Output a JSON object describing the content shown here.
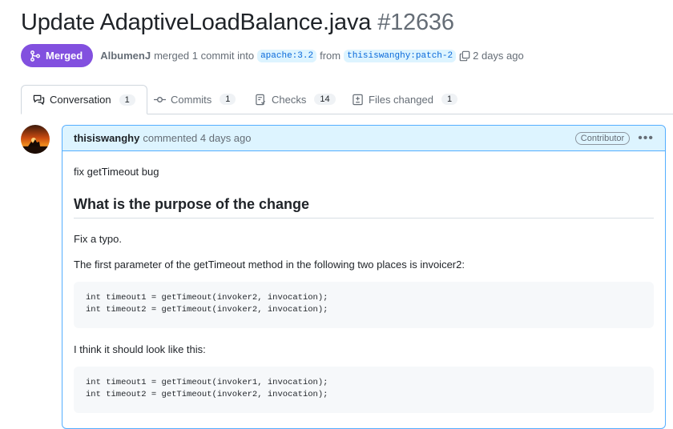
{
  "pr": {
    "title": "Update AdaptiveLoadBalance.java",
    "number": "#12636",
    "status": "Merged",
    "author": "AlbumenJ",
    "merge_text": "merged 1 commit into",
    "base_branch": "apache:3.2",
    "from_text": "from",
    "head_branch": "thisiswanghy:patch-2",
    "time": "2 days ago"
  },
  "tabs": [
    {
      "label": "Conversation",
      "count": "1",
      "icon": "conversation-icon"
    },
    {
      "label": "Commits",
      "count": "1",
      "icon": "commit-icon"
    },
    {
      "label": "Checks",
      "count": "14",
      "icon": "checks-icon"
    },
    {
      "label": "Files changed",
      "count": "1",
      "icon": "diff-icon"
    }
  ],
  "comment": {
    "author": "thisiswanghy",
    "action": "commented 4 days ago",
    "role": "Contributor",
    "intro": "fix getTimeout bug",
    "heading": "What is the purpose of the change",
    "p1": "Fix a typo.",
    "p2": "The first parameter of the getTimeout method in the following two places is invoicer2:",
    "code1": "int timeout1 = getTimeout(invoker2, invocation);\nint timeout2 = getTimeout(invoker2, invocation);",
    "p3": "I think it should look like this:",
    "code2": "int timeout1 = getTimeout(invoker1, invocation);\nint timeout2 = getTimeout(invoker2, invocation);"
  },
  "colors": {
    "merged": "#8250df",
    "link": "#0969da",
    "header_bg": "#ddf4ff"
  }
}
